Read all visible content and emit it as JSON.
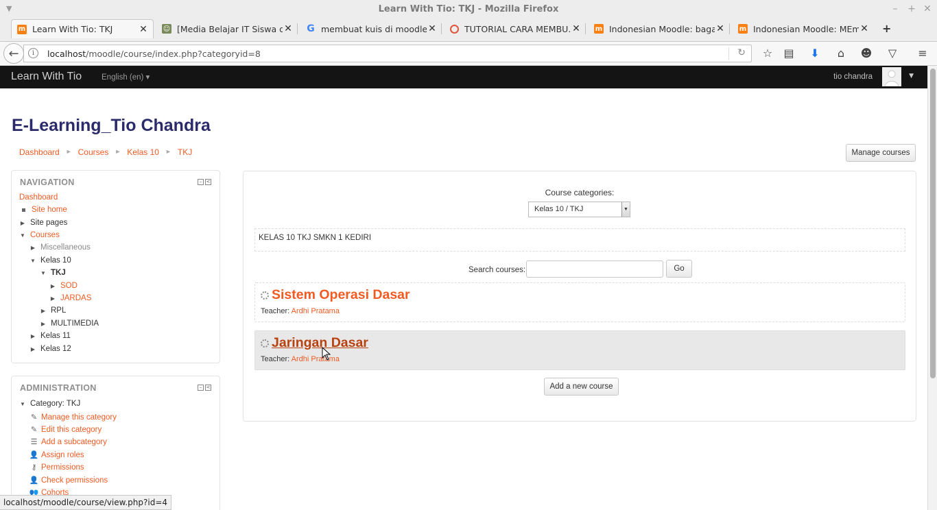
{
  "window": {
    "title": "Learn With Tio: TKJ - Mozilla Firefox"
  },
  "tabs": [
    {
      "label": "Learn With Tio: TKJ",
      "favicon": "moodle-icon",
      "active": true
    },
    {
      "label": "[Media Belajar IT Siswa d...",
      "favicon": "media-icon",
      "active": false
    },
    {
      "label": "membuat kuis di moodle ...",
      "favicon": "google-icon",
      "active": false
    },
    {
      "label": "TUTORIAL CARA MEMBU...",
      "favicon": "tutorial-icon",
      "active": false
    },
    {
      "label": "Indonesian Moodle: baga...",
      "favicon": "moodle-icon",
      "active": false
    },
    {
      "label": "Indonesian Moodle: MEm...",
      "favicon": "moodle-icon",
      "active": false
    }
  ],
  "urlbar": {
    "host": "localhost",
    "path": "/moodle/course/index.php?categoryid=8"
  },
  "moodle": {
    "brand": "Learn With Tio",
    "language": "English (en) ▾",
    "username": "tio chandra",
    "heading": "E-Learning_Tio Chandra",
    "breadcrumb": [
      "Dashboard",
      "Courses",
      "Kelas 10",
      "TKJ"
    ],
    "manage_courses": "Manage courses"
  },
  "navigation": {
    "title": "NAVIGATION",
    "dashboard": "Dashboard",
    "site_home": "Site home",
    "site_pages": "Site pages",
    "courses": "Courses",
    "miscellaneous": "Miscellaneous",
    "kelas10": "Kelas 10",
    "tkj": "TKJ",
    "sod": "SOD",
    "jardas": "JARDAS",
    "rpl": "RPL",
    "multimedia": "MULTIMEDIA",
    "kelas11": "Kelas 11",
    "kelas12": "Kelas 12"
  },
  "administration": {
    "title": "ADMINISTRATION",
    "category": "Category: TKJ",
    "items": [
      "Manage this category",
      "Edit this category",
      "Add a subcategory",
      "Assign roles",
      "Permissions",
      "Check permissions",
      "Cohorts"
    ]
  },
  "main": {
    "categories_label": "Course categories:",
    "category_selected": "Kelas 10 / TKJ",
    "category_description": "KELAS 10 TKJ SMKN 1 KEDIRI",
    "search_label": "Search courses:",
    "search_value": "",
    "go_label": "Go",
    "courses": [
      {
        "title": "Sistem Operasi Dasar",
        "teacher_label": "Teacher:",
        "teacher": "Ardhi Pratama"
      },
      {
        "title": "Jaringan Dasar",
        "teacher_label": "Teacher:",
        "teacher": "Ardhi Pratama"
      }
    ],
    "add_course": "Add a new course"
  },
  "status": {
    "url": "localhost/moodle/course/view.php?id=4"
  },
  "colors": {
    "accent": "#f15a22",
    "navbar": "#141414",
    "heading": "#2b2b6b"
  }
}
